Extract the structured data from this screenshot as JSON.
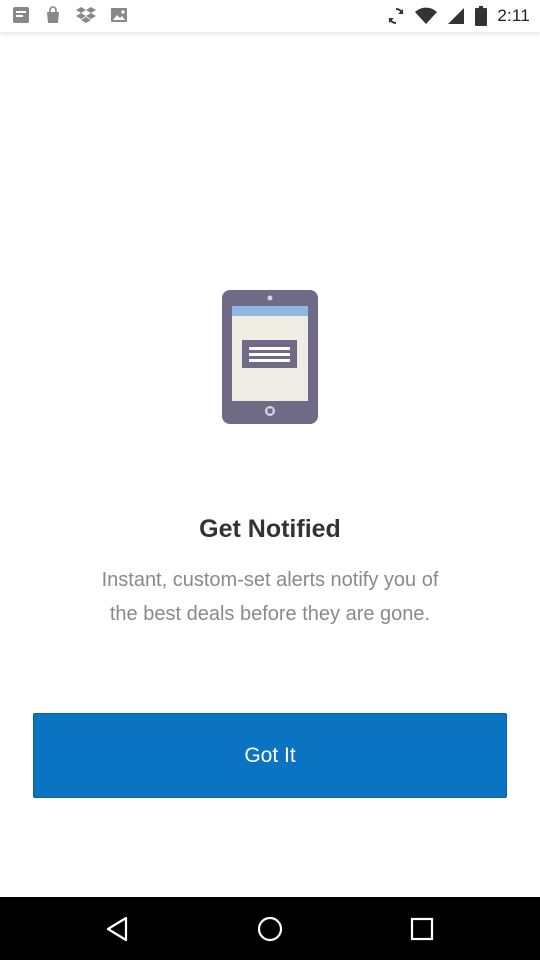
{
  "status_bar": {
    "time": "2:11",
    "left_icons": [
      "app-notification-icon",
      "shopping-bag-icon",
      "dropbox-icon",
      "image-icon"
    ],
    "right_icons": [
      "sync-icon",
      "wifi-icon",
      "signal-icon",
      "battery-icon"
    ]
  },
  "onboarding": {
    "illustration": "tablet-notification-icon",
    "title": "Get Notified",
    "description": "Instant, custom-set alerts notify you of the best deals before they are gone.",
    "button_label": "Got It",
    "accent_color": "#0a73c2"
  },
  "nav_bar": {
    "buttons": [
      "back-icon",
      "home-icon",
      "recents-icon"
    ]
  }
}
